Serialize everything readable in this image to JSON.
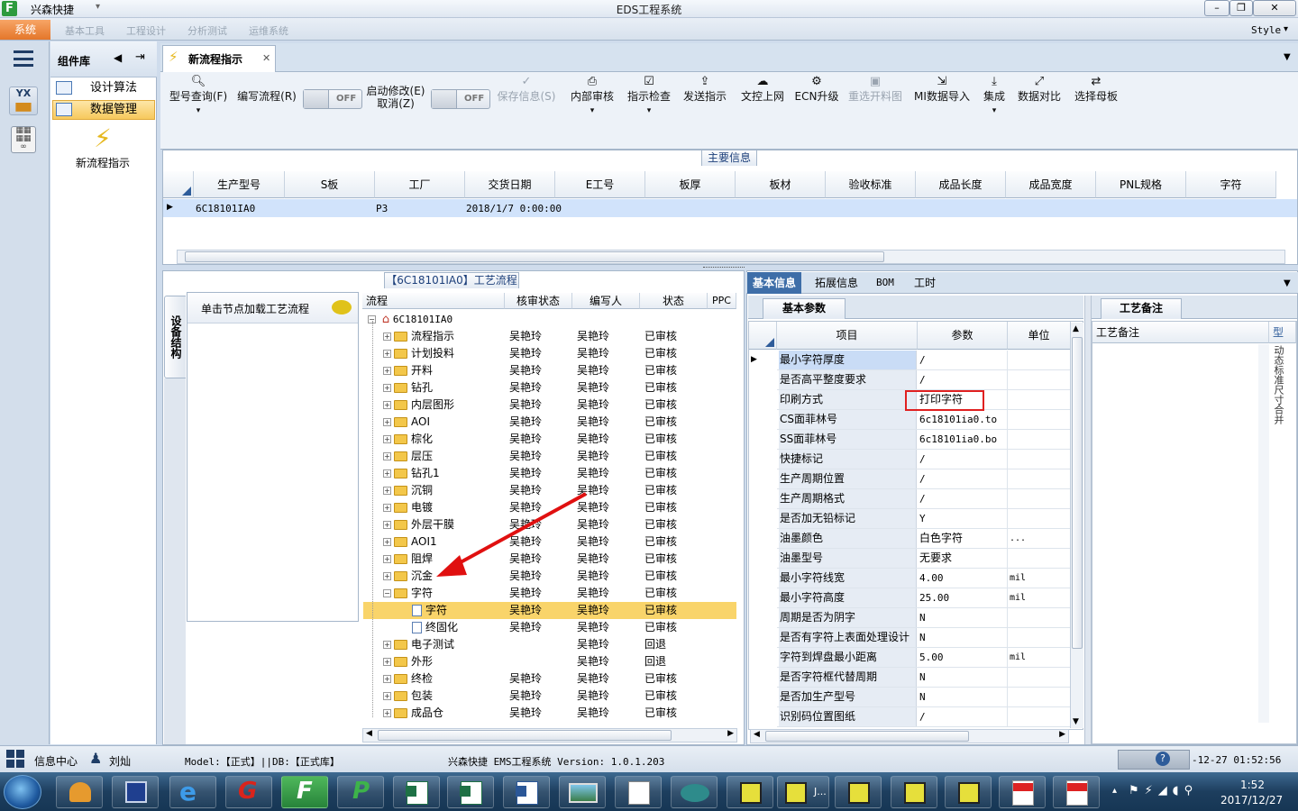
{
  "window": {
    "app_name": "兴森快捷",
    "title": "EDS工程系统",
    "style_label": "Style"
  },
  "menu": {
    "system": "系统",
    "tabs": [
      "基本工具",
      "工程设计",
      "分析测试",
      "运维系统"
    ]
  },
  "sidebar": {
    "header": "组件库",
    "items": [
      {
        "label": "设计算法"
      },
      {
        "label": "数据管理"
      }
    ],
    "big_button": "新流程指示"
  },
  "doc_tab": {
    "label": "新流程指示"
  },
  "toolbar": {
    "buttons": [
      {
        "label": "型号查询(F)",
        "icon": "search-icon"
      },
      {
        "label": "编写流程(R)",
        "icon": ""
      },
      {
        "label": "启动修改(E)",
        "label2": "取消(Z)",
        "icon": ""
      },
      {
        "label": "保存信息(S)",
        "icon": "check-icon"
      },
      {
        "label": "内部审核",
        "icon": "printer-icon"
      },
      {
        "label": "指示检查",
        "icon": "checkbox-icon"
      },
      {
        "label": "发送指示",
        "icon": "upload-icon"
      },
      {
        "label": "文控上网",
        "icon": "cloud-icon"
      },
      {
        "label": "ECN升级",
        "icon": "gear-icon"
      },
      {
        "label": "重选开料图",
        "icon": "image-icon"
      },
      {
        "label": "MI数据导入",
        "icon": "import-icon"
      },
      {
        "label": "集成",
        "icon": "download-icon"
      },
      {
        "label": "数据对比",
        "icon": "compare-icon"
      },
      {
        "label": "选择母板",
        "icon": "shuffle-icon"
      }
    ],
    "toggle_off": "OFF"
  },
  "main_info": {
    "title": "主要信息",
    "columns": [
      "生产型号",
      "S板",
      "工厂",
      "交货日期",
      "E工号",
      "板厚",
      "板材",
      "验收标准",
      "成品长度",
      "成品宽度",
      "PNL规格",
      "字符"
    ],
    "row": {
      "model": "6C18101IA0",
      "factory": "P3",
      "date": "2018/1/7 0:00:00"
    }
  },
  "process": {
    "title": "【6C18101IA0】工艺流程",
    "side_tab": "设备结构",
    "hint": "单击节点加载工艺流程",
    "columns": [
      "流程",
      "核审状态",
      "编写人",
      "状态",
      "PPC"
    ],
    "root": "6C18101IA0",
    "rows": [
      {
        "name": "流程指示",
        "review": "吴艳玲",
        "author": "吴艳玲",
        "status": "已审核",
        "type": "folder"
      },
      {
        "name": "计划投料",
        "review": "吴艳玲",
        "author": "吴艳玲",
        "status": "已审核",
        "type": "folder"
      },
      {
        "name": "开料",
        "review": "吴艳玲",
        "author": "吴艳玲",
        "status": "已审核",
        "type": "folder"
      },
      {
        "name": "钻孔",
        "review": "吴艳玲",
        "author": "吴艳玲",
        "status": "已审核",
        "type": "folder"
      },
      {
        "name": "内层图形",
        "review": "吴艳玲",
        "author": "吴艳玲",
        "status": "已审核",
        "type": "folder"
      },
      {
        "name": "AOI",
        "review": "吴艳玲",
        "author": "吴艳玲",
        "status": "已审核",
        "type": "folder"
      },
      {
        "name": "棕化",
        "review": "吴艳玲",
        "author": "吴艳玲",
        "status": "已审核",
        "type": "folder"
      },
      {
        "name": "层压",
        "review": "吴艳玲",
        "author": "吴艳玲",
        "status": "已审核",
        "type": "folder"
      },
      {
        "name": "钻孔1",
        "review": "吴艳玲",
        "author": "吴艳玲",
        "status": "已审核",
        "type": "folder"
      },
      {
        "name": "沉铜",
        "review": "吴艳玲",
        "author": "吴艳玲",
        "status": "已审核",
        "type": "folder"
      },
      {
        "name": "电镀",
        "review": "吴艳玲",
        "author": "吴艳玲",
        "status": "已审核",
        "type": "folder"
      },
      {
        "name": "外层干膜",
        "review": "吴艳玲",
        "author": "吴艳玲",
        "status": "已审核",
        "type": "folder"
      },
      {
        "name": "AOI1",
        "review": "吴艳玲",
        "author": "吴艳玲",
        "status": "已审核",
        "type": "folder"
      },
      {
        "name": "阻焊",
        "review": "吴艳玲",
        "author": "吴艳玲",
        "status": "已审核",
        "type": "folder"
      },
      {
        "name": "沉金",
        "review": "吴艳玲",
        "author": "吴艳玲",
        "status": "已审核",
        "type": "folder"
      },
      {
        "name": "字符",
        "review": "吴艳玲",
        "author": "吴艳玲",
        "status": "已审核",
        "type": "folder-open"
      },
      {
        "name": "字符",
        "review": "吴艳玲",
        "author": "吴艳玲",
        "status": "已审核",
        "type": "child-selected"
      },
      {
        "name": "终固化",
        "review": "吴艳玲",
        "author": "吴艳玲",
        "status": "已审核",
        "type": "child"
      },
      {
        "name": "电子测试",
        "review": "",
        "author": "吴艳玲",
        "status": "回退",
        "type": "folder"
      },
      {
        "name": "外形",
        "review": "",
        "author": "吴艳玲",
        "status": "回退",
        "type": "folder"
      },
      {
        "name": "终检",
        "review": "吴艳玲",
        "author": "吴艳玲",
        "status": "已审核",
        "type": "folder"
      },
      {
        "name": "包装",
        "review": "吴艳玲",
        "author": "吴艳玲",
        "status": "已审核",
        "type": "folder"
      },
      {
        "name": "成品仓",
        "review": "吴艳玲",
        "author": "吴艳玲",
        "status": "已审核",
        "type": "folder"
      }
    ]
  },
  "right": {
    "tabs": [
      "基本信息",
      "拓展信息",
      "BOM",
      "工时"
    ],
    "subtab": "基本参数",
    "columns": [
      "项目",
      "参数",
      "单位"
    ],
    "params": [
      {
        "k": "最小字符厚度",
        "v": "/",
        "u": ""
      },
      {
        "k": "是否高平整度要求",
        "v": "/",
        "u": ""
      },
      {
        "k": "印刷方式",
        "v": "打印字符",
        "u": ""
      },
      {
        "k": "CS面菲林号",
        "v": "6c18101ia0.to",
        "u": ""
      },
      {
        "k": "SS面菲林号",
        "v": "6c18101ia0.bo",
        "u": ""
      },
      {
        "k": "快捷标记",
        "v": "/",
        "u": ""
      },
      {
        "k": "生产周期位置",
        "v": "/",
        "u": ""
      },
      {
        "k": "生产周期格式",
        "v": "/",
        "u": ""
      },
      {
        "k": "是否加无铅标记",
        "v": "Y",
        "u": ""
      },
      {
        "k": "油墨颜色",
        "v": "白色字符",
        "u": "..."
      },
      {
        "k": "油墨型号",
        "v": "无要求",
        "u": ""
      },
      {
        "k": "最小字符线宽",
        "v": "4.00",
        "u": "mil"
      },
      {
        "k": "最小字符高度",
        "v": "25.00",
        "u": "mil"
      },
      {
        "k": "周期是否为阴字",
        "v": "N",
        "u": ""
      },
      {
        "k": "是否有字符上表面处理设计",
        "v": "N",
        "u": ""
      },
      {
        "k": "字符到焊盘最小距离",
        "v": "5.00",
        "u": "mil"
      },
      {
        "k": "是否字符框代替周期",
        "v": "N",
        "u": ""
      },
      {
        "k": "是否加生产型号",
        "v": "N",
        "u": ""
      },
      {
        "k": "识别码位置图纸",
        "v": "/",
        "u": ""
      }
    ],
    "notes_tab": "工艺备注",
    "notes_header": "工艺备注",
    "notes_col2": "型",
    "notes_side_text": "动态标准尺寸合并"
  },
  "status": {
    "info_center": "信息中心",
    "user": "刘灿",
    "model": "Model:【正式】||DB:【正式库】",
    "system": "兴森快捷 EMS工程系统 Version: 1.0.1.203",
    "datetime": "-12-27 01:52:56"
  },
  "taskbar": {
    "time": "1:52",
    "date": "2017/12/27"
  },
  "colors": {
    "accent": "#e4762a",
    "selected_row": "#f9d46a",
    "highlight_box": "#e02020",
    "arrow": "#e01010"
  }
}
